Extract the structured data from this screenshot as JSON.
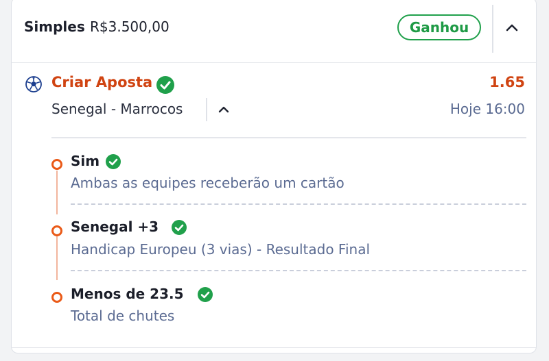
{
  "header": {
    "bet_type": "Simples",
    "stake": "R$3.500,00",
    "status": "Ganhou",
    "collapse_icon": "chevron-up-icon"
  },
  "selection": {
    "sport_icon": "soccer-ball-icon",
    "market_title": "Criar Aposta",
    "odds": "1.65",
    "event": "Senegal - Marrocos",
    "event_toggle_icon": "chevron-up-icon",
    "time": "Hoje 16:00"
  },
  "legs": [
    {
      "pick": "Sim",
      "market": "Ambas as equipes receberão um cartão"
    },
    {
      "pick": "Senegal +3",
      "market": "Handicap Europeu (3 vias) - Resultado Final"
    },
    {
      "pick": "Menos de 23.5",
      "market": "Total de chutes"
    }
  ],
  "colors": {
    "accent_red": "#d04412",
    "won_green": "#20a04b",
    "leg_orange": "#ea5a18",
    "muted_blue": "#5b6b92"
  }
}
